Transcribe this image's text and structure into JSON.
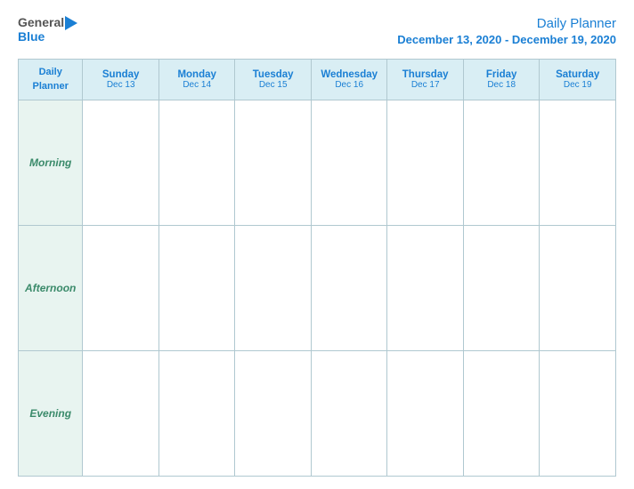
{
  "header": {
    "logo": {
      "general": "General",
      "blue": "Blue"
    },
    "title": "Daily Planner",
    "date_range": "December 13, 2020 - December 19, 2020"
  },
  "table": {
    "header_first": {
      "line1": "Daily",
      "line2": "Planner"
    },
    "columns": [
      {
        "day": "Sunday",
        "date": "Dec 13"
      },
      {
        "day": "Monday",
        "date": "Dec 14"
      },
      {
        "day": "Tuesday",
        "date": "Dec 15"
      },
      {
        "day": "Wednesday",
        "date": "Dec 16"
      },
      {
        "day": "Thursday",
        "date": "Dec 17"
      },
      {
        "day": "Friday",
        "date": "Dec 18"
      },
      {
        "day": "Saturday",
        "date": "Dec 19"
      }
    ],
    "rows": [
      {
        "label": "Morning"
      },
      {
        "label": "Afternoon"
      },
      {
        "label": "Evening"
      }
    ]
  }
}
